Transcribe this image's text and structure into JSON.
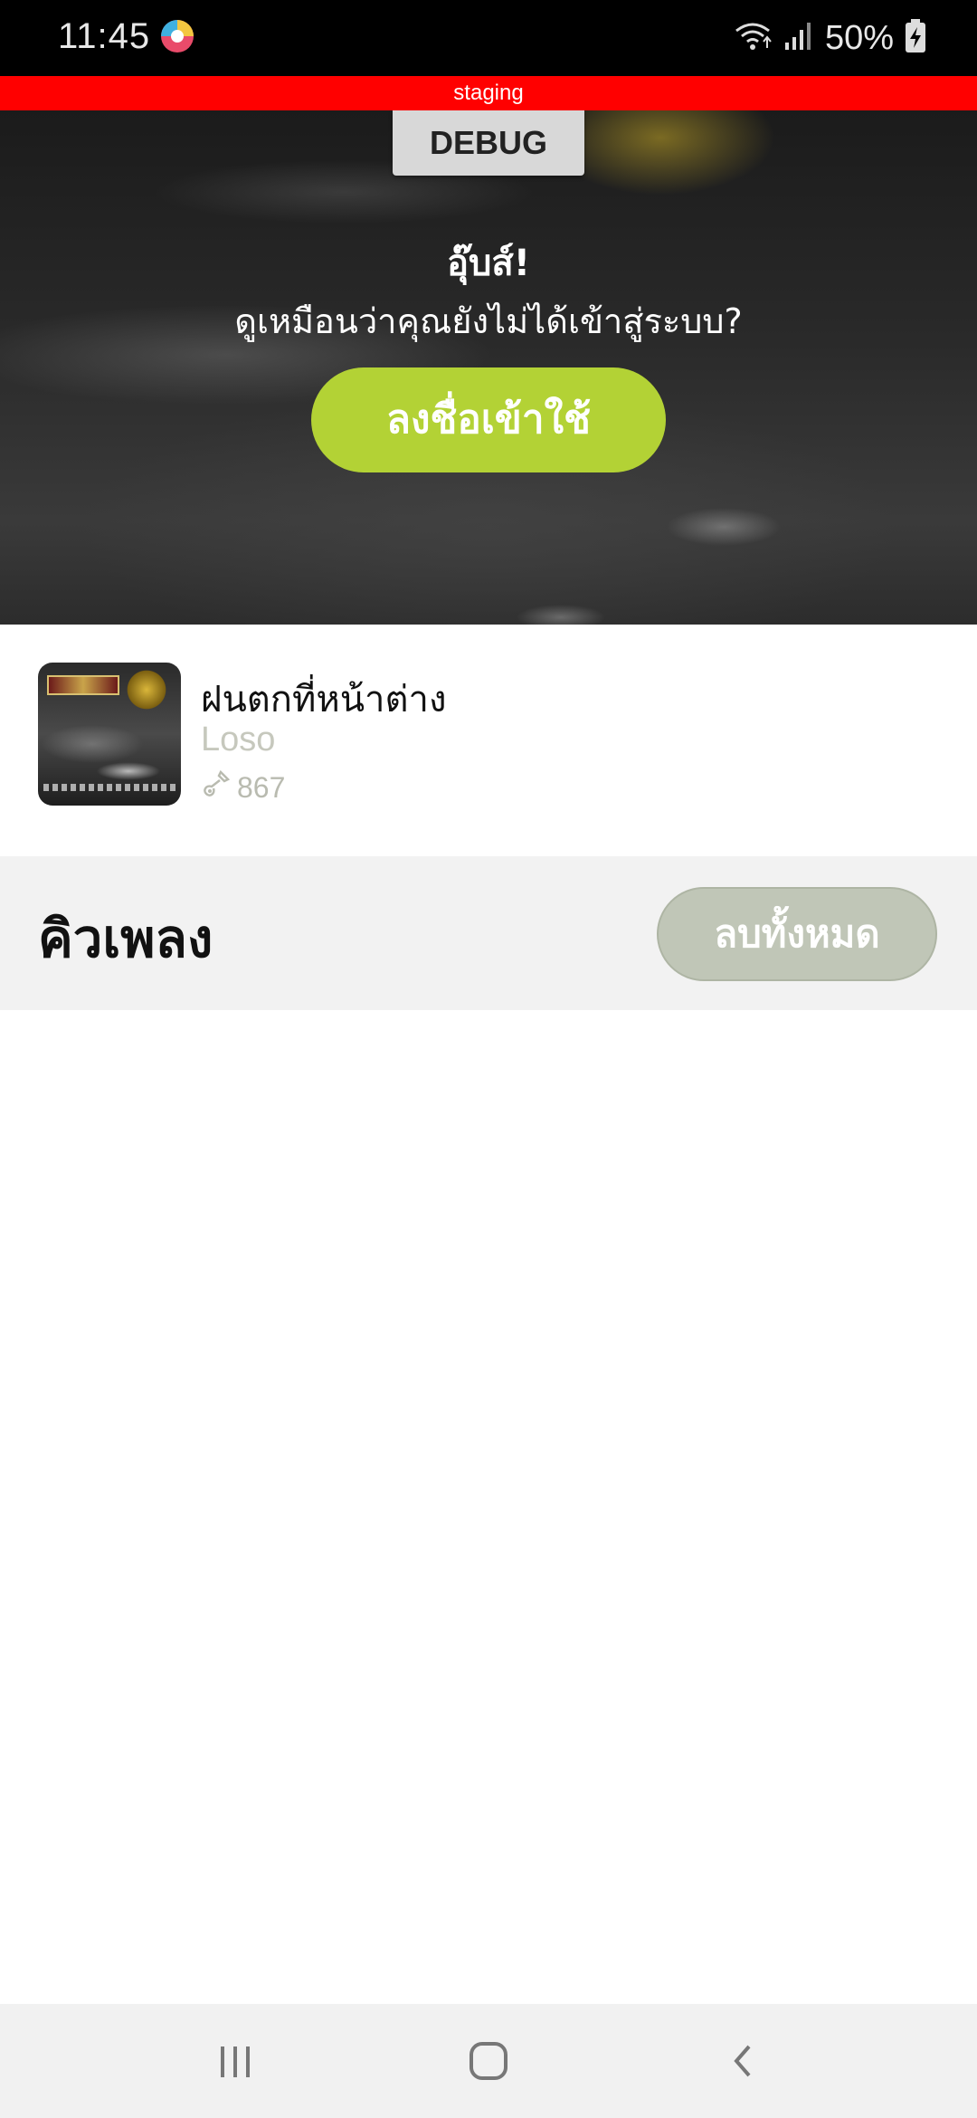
{
  "status_bar": {
    "time": "11:45",
    "battery": "50%",
    "icons": [
      "app-notification-icon",
      "wifi-icon",
      "signal-icon",
      "battery-charging-icon"
    ]
  },
  "env_banner": {
    "label": "staging"
  },
  "hero": {
    "debug_label": "DEBUG",
    "title": "อุ๊บส์!",
    "subtitle": "ดูเหมือนว่าคุณยังไม่ได้เข้าสู่ระบบ?",
    "login_label": "ลงชื่อเข้าใช้",
    "login_color": "#b3d235"
  },
  "now_playing": {
    "title": "ฝนตกที่หน้าต่าง",
    "artist": "Loso",
    "plays": "867",
    "plays_icon": "guitar-icon"
  },
  "queue": {
    "title": "คิวเพลง",
    "clear_label": "ลบทั้งหมด",
    "items": []
  },
  "nav_bar": {
    "buttons": [
      "recent-apps-icon",
      "home-icon",
      "back-icon"
    ]
  }
}
